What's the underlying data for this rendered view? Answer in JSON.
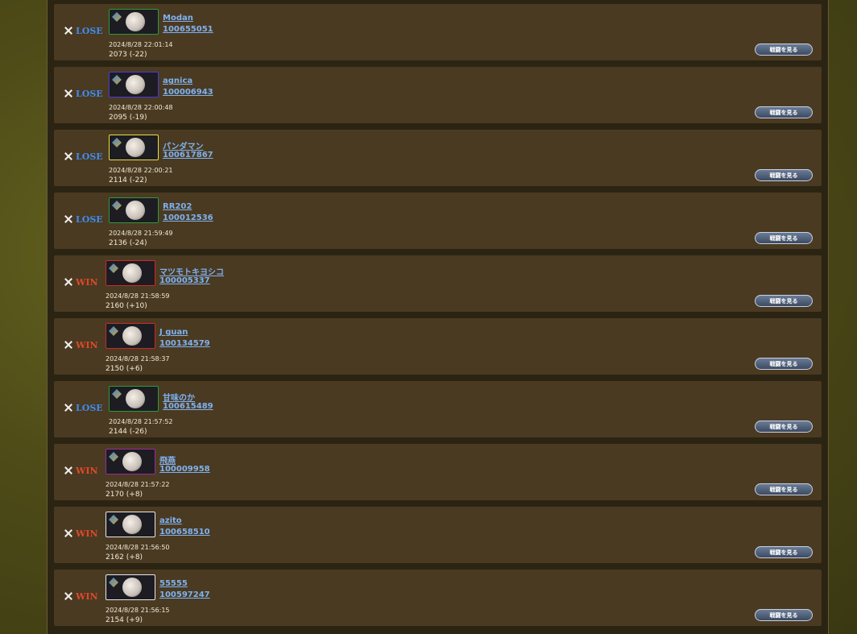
{
  "button_label": "戦闘を見る",
  "colors": {
    "win": "#e0482a",
    "lose": "#3f8df0",
    "link": "#7fb2f0"
  },
  "matches": [
    {
      "result": "LOSE",
      "name": "Modan",
      "id": "100655051",
      "time": "2024/8/28 22:01:14",
      "rating": "2073 (-22)",
      "frame": "#2e9a3a"
    },
    {
      "result": "LOSE",
      "name": "agnica",
      "id": "100006943",
      "time": "2024/8/28 22:00:48",
      "rating": "2095 (-19)",
      "frame": "#4a3ad8"
    },
    {
      "result": "LOSE",
      "name": "パンダマン",
      "id": "100617867",
      "time": "2024/8/28 22:00:21",
      "rating": "2114 (-22)",
      "frame": "#e8e040"
    },
    {
      "result": "LOSE",
      "name": "RR202",
      "id": "100012536",
      "time": "2024/8/28 21:59:49",
      "rating": "2136 (-24)",
      "frame": "#2e9a3a"
    },
    {
      "result": "WIN",
      "name": "マツモトキヨシコ",
      "id": "100005337",
      "time": "2024/8/28 21:58:59",
      "rating": "2160 (+10)",
      "frame": "#d02828"
    },
    {
      "result": "WIN",
      "name": "J guan",
      "id": "100134579",
      "time": "2024/8/28 21:58:37",
      "rating": "2150 (+6)",
      "frame": "#d02828"
    },
    {
      "result": "LOSE",
      "name": "甘味のか",
      "id": "100615489",
      "time": "2024/8/28 21:57:52",
      "rating": "2144 (-26)",
      "frame": "#2e9a3a"
    },
    {
      "result": "WIN",
      "name": "飛燕",
      "id": "100009958",
      "time": "2024/8/28 21:57:22",
      "rating": "2170 (+8)",
      "frame": "#9a2a9a"
    },
    {
      "result": "WIN",
      "name": "azito",
      "id": "100658510",
      "time": "2024/8/28 21:56:50",
      "rating": "2162 (+8)",
      "frame": "#e8e8e8"
    },
    {
      "result": "WIN",
      "name": "55555",
      "id": "100597247",
      "time": "2024/8/28 21:56:15",
      "rating": "2154 (+9)",
      "frame": "#e8e8e8"
    }
  ]
}
